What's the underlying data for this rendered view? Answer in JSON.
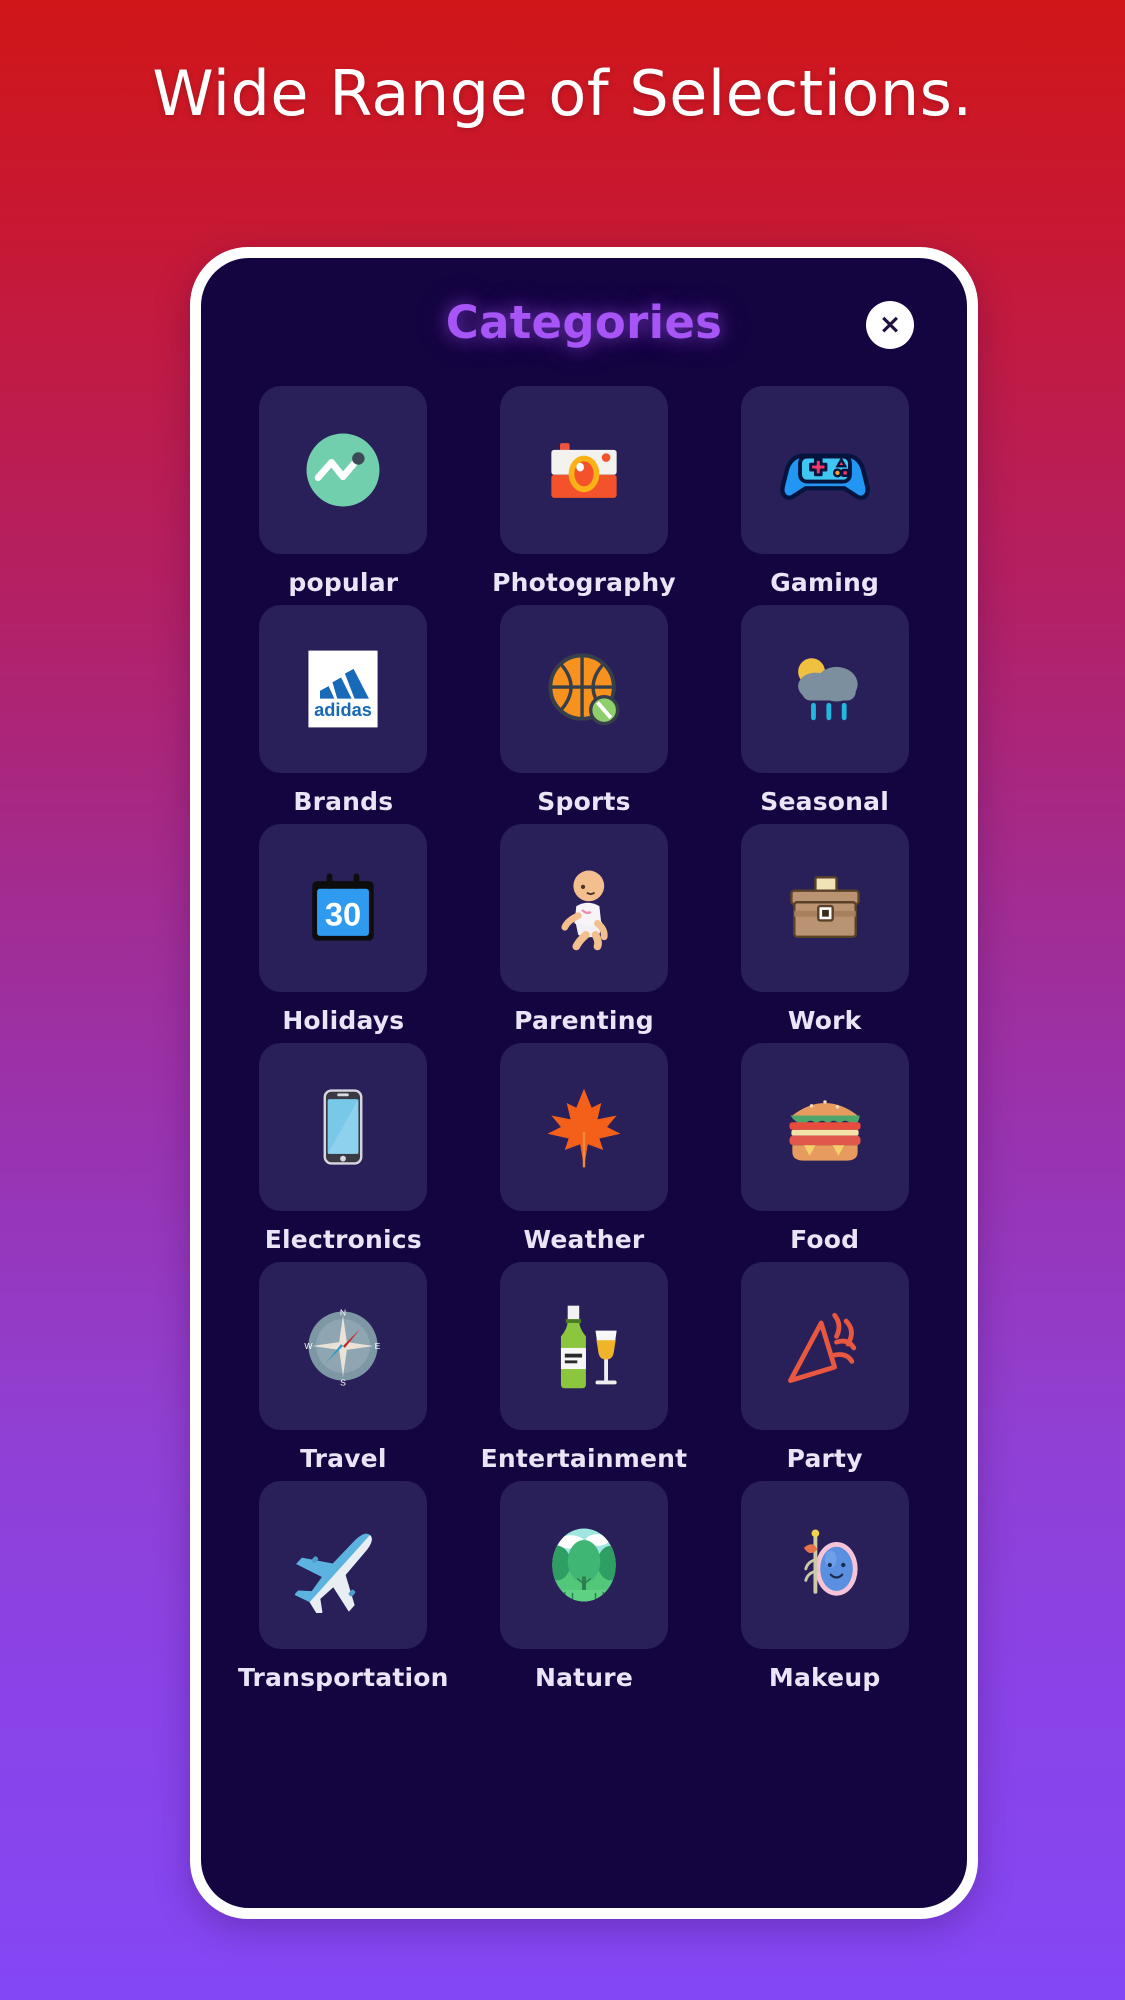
{
  "heading": "Wide Range of Selections.",
  "modal": {
    "title": "Categories",
    "close_label": "×",
    "close_icon": "close-icon"
  },
  "theme": {
    "background_gradient_top": "#d01618",
    "background_gradient_bottom": "#8447f5",
    "phone_frame": "#ffffff",
    "screen_background": "#140440",
    "tile_background": "#2a2059",
    "title_color": "#a855f7",
    "label_color": "#e9e4f6"
  },
  "categories": [
    {
      "label": "popular",
      "icon": "trending-chart-icon"
    },
    {
      "label": "Photography",
      "icon": "camera-icon"
    },
    {
      "label": "Gaming",
      "icon": "game-controller-icon"
    },
    {
      "label": "Brands",
      "icon": "adidas-logo-icon"
    },
    {
      "label": "Sports",
      "icon": "basketball-icon"
    },
    {
      "label": "Seasonal",
      "icon": "sun-rain-cloud-icon"
    },
    {
      "label": "Holidays",
      "icon": "calendar-30-icon"
    },
    {
      "label": "Parenting",
      "icon": "baby-icon"
    },
    {
      "label": "Work",
      "icon": "briefcase-icon"
    },
    {
      "label": "Electronics",
      "icon": "smartphone-icon"
    },
    {
      "label": "Weather",
      "icon": "maple-leaf-icon"
    },
    {
      "label": "Food",
      "icon": "hamburger-icon"
    },
    {
      "label": "Travel",
      "icon": "compass-icon"
    },
    {
      "label": "Entertainment",
      "icon": "champagne-bottle-glass-icon"
    },
    {
      "label": "Party",
      "icon": "party-popper-icon"
    },
    {
      "label": "Transportation",
      "icon": "airplane-icon"
    },
    {
      "label": "Nature",
      "icon": "nature-trees-icon"
    },
    {
      "label": "Makeup",
      "icon": "makeup-mirror-icon"
    }
  ],
  "calendar_day": "30",
  "compass_directions": [
    "N",
    "E",
    "S",
    "W"
  ],
  "brand_wordmark": "adidas"
}
